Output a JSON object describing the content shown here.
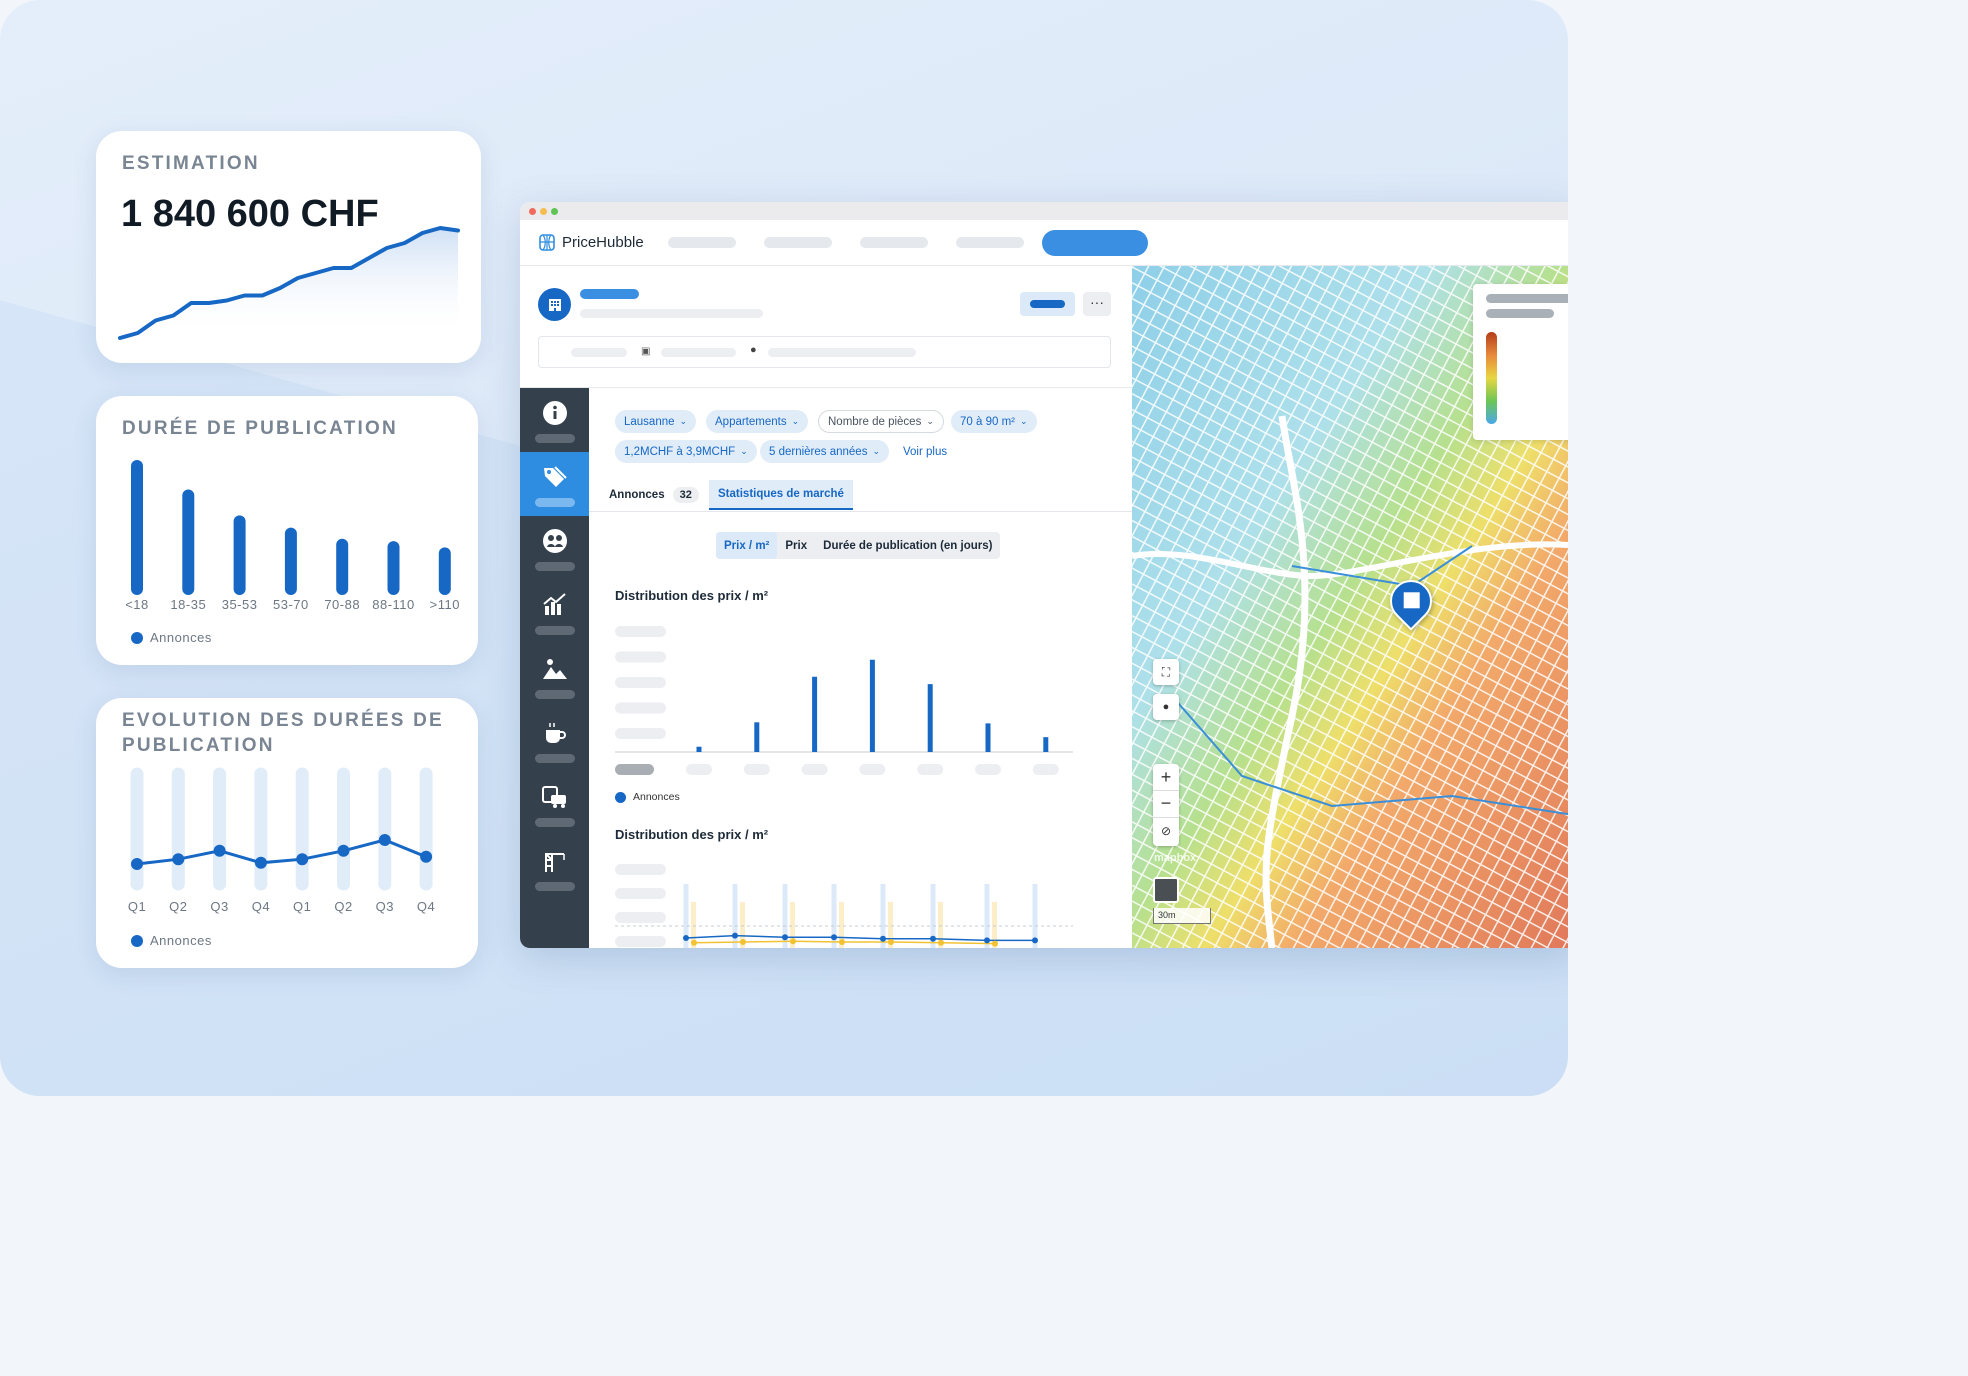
{
  "estimation": {
    "title": "ESTIMATION",
    "value": "1 840 600 CHF"
  },
  "duree": {
    "title": "DURÉE DE PUBLICATION",
    "legend": "Annonces"
  },
  "evolution": {
    "title_line1": "EVOLUTION DES DURÉES DE",
    "title_line2": "PUBLICATION",
    "legend": "Annonces"
  },
  "app": {
    "brand": "PriceHubble"
  },
  "filters": {
    "city": "Lausanne",
    "type": "Appartements",
    "rooms": "Nombre de pièces",
    "area": "70 à 90 m²",
    "price": "1,2MCHF à 3,9MCHF",
    "period": "5 dernières années",
    "more": "Voir plus"
  },
  "tabs": {
    "annonces": "Annonces",
    "annonces_count": "32",
    "stats": "Statistiques de marché"
  },
  "segment": {
    "a": "Prix / m²",
    "b": "Prix",
    "c": "Durée de publication (en jours)"
  },
  "section1": {
    "title": "Distribution des prix / m²",
    "legend": "Annonces"
  },
  "section2": {
    "title": "Distribution des prix / m²"
  },
  "map": {
    "attribution": "mapbox",
    "scale": "30m"
  },
  "colors": {
    "accent": "#1768c4",
    "sidebar": "#34404c",
    "active": "#2e8de0"
  },
  "chart_data": [
    {
      "type": "line",
      "title": "ESTIMATION",
      "series": [
        {
          "values": [
            2,
            4,
            9,
            11,
            16,
            16,
            17,
            19,
            19,
            22,
            26,
            28,
            30,
            30,
            34,
            38,
            40,
            44,
            46,
            45
          ]
        }
      ],
      "ylim": [
        0,
        48
      ]
    },
    {
      "type": "bar",
      "title": "DURÉE DE PUBLICATION",
      "categories": [
        "<18",
        "18-35",
        "35-53",
        "53-70",
        "70-88",
        "88-110",
        ">110"
      ],
      "series": [
        {
          "name": "Annonces",
          "values": [
            10,
            7.6,
            5.5,
            4.5,
            3.6,
            3.4,
            2.9
          ]
        }
      ],
      "ylim": [
        0,
        10
      ]
    },
    {
      "type": "line",
      "title": "EVOLUTION DES DURÉES DE PUBLICATION",
      "categories": [
        "Q1",
        "Q2",
        "Q3",
        "Q4",
        "Q1",
        "Q2",
        "Q3",
        "Q4"
      ],
      "series": [
        {
          "name": "Annonces",
          "values": [
            2.0,
            2.4,
            3.1,
            2.1,
            2.4,
            3.1,
            4.0,
            2.6
          ]
        }
      ],
      "ylim": [
        0,
        10
      ]
    },
    {
      "type": "bar",
      "title": "Distribution des prix / m²",
      "series": [
        {
          "name": "Annonces",
          "values": [
            5,
            28,
            71,
            87,
            64,
            27,
            14
          ]
        }
      ],
      "ylim": [
        0,
        100
      ]
    },
    {
      "type": "line",
      "title": "Distribution des prix / m²",
      "series": [
        {
          "values": [
            50,
            53,
            51,
            51,
            49,
            49,
            47,
            47
          ]
        },
        {
          "values": [
            44,
            45,
            46,
            45,
            45,
            44,
            43
          ]
        }
      ],
      "ylim": [
        0,
        100
      ]
    }
  ]
}
